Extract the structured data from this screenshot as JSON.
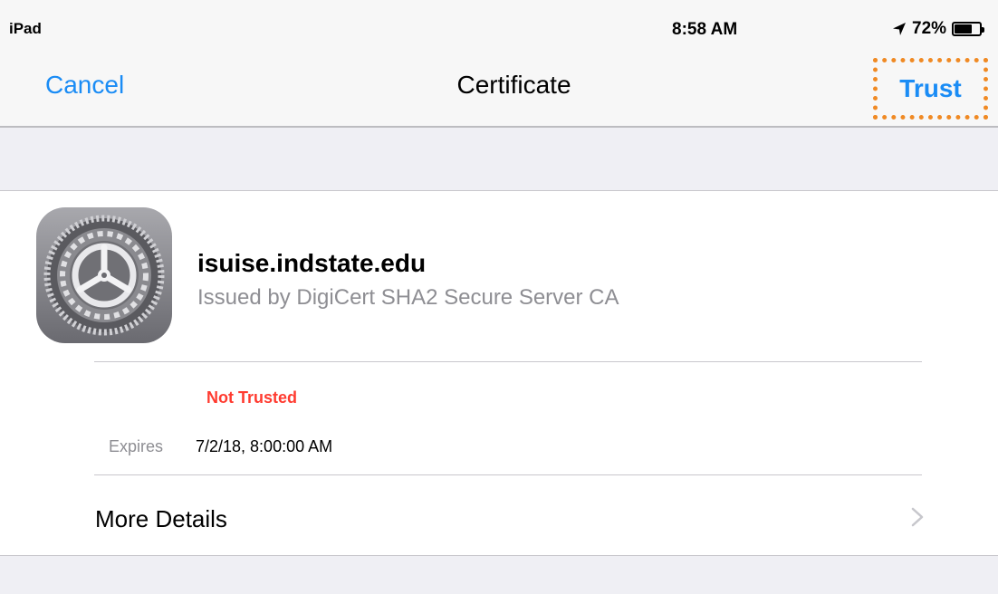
{
  "status_bar": {
    "device": "iPad",
    "time": "8:58 AM",
    "battery_percent": "72%",
    "battery_level": 0.72,
    "icons": [
      "location-arrow-icon",
      "battery-icon"
    ]
  },
  "nav_bar": {
    "cancel_label": "Cancel",
    "title": "Certificate",
    "trust_label": "Trust",
    "accent_color": "#1a8cf5",
    "highlight_color": "#f08a24"
  },
  "certificate": {
    "icon": "settings-gear-icon",
    "name": "isuise.indstate.edu",
    "issuer": "Issued by DigiCert SHA2 Secure Server CA",
    "status": "Not Trusted",
    "status_color": "#ff3b30",
    "expires_label": "Expires",
    "expires_value": "7/2/18, 8:00:00 AM"
  },
  "more_details": {
    "label": "More Details",
    "icon": "chevron-right-icon"
  }
}
